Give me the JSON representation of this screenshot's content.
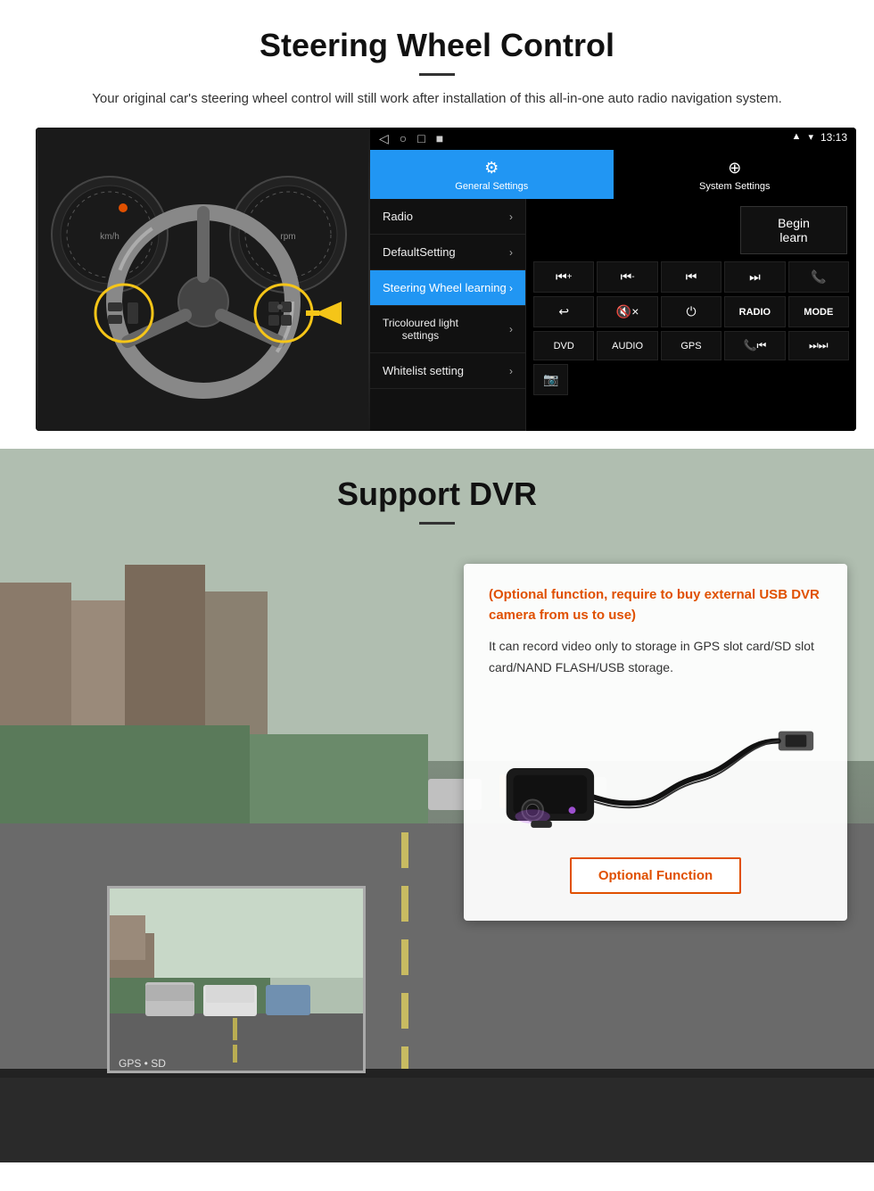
{
  "steering_section": {
    "title": "Steering Wheel Control",
    "description": "Your original car's steering wheel control will still work after installation of this all-in-one auto radio navigation system.",
    "android_panel": {
      "statusbar": {
        "time": "13:13",
        "nav_icons": [
          "◁",
          "○",
          "□",
          "■"
        ]
      },
      "tabs": [
        {
          "icon": "⚙",
          "label": "General Settings",
          "active": true
        },
        {
          "icon": "⊕",
          "label": "System Settings",
          "active": false
        }
      ],
      "menu_items": [
        {
          "label": "Radio",
          "active": false
        },
        {
          "label": "DefaultSetting",
          "active": false
        },
        {
          "label": "Steering Wheel learning",
          "active": true
        },
        {
          "label": "Tricoloured light settings",
          "active": false
        },
        {
          "label": "Whitelist setting",
          "active": false
        }
      ],
      "begin_learn_label": "Begin learn",
      "control_buttons_row1": [
        "⏮+",
        "⏮-",
        "⏮",
        "⏭",
        "📞"
      ],
      "control_buttons_row2": [
        "↩",
        "🔇×",
        "⏻",
        "RADIO",
        "MODE"
      ],
      "control_buttons_row3": [
        "DVD",
        "AUDIO",
        "GPS",
        "📞⏮",
        "⏭⏭"
      ],
      "control_buttons_row4": [
        "📷"
      ]
    }
  },
  "dvr_section": {
    "title": "Support DVR",
    "optional_notice": "(Optional function, require to buy external USB DVR camera from us to use)",
    "description": "It can record video only to storage in GPS slot card/SD slot card/NAND FLASH/USB storage.",
    "optional_function_label": "Optional Function"
  }
}
